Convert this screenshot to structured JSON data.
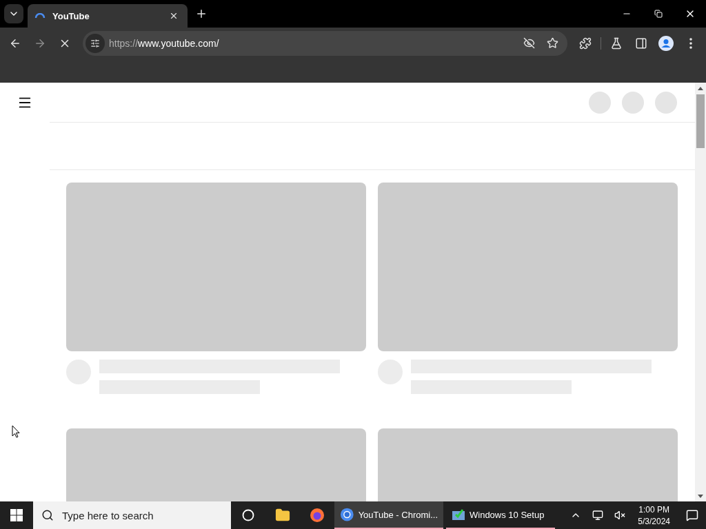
{
  "browser": {
    "tabs": [
      {
        "title": "YouTube",
        "selected": true,
        "loading": true
      }
    ],
    "address": {
      "scheme": "https://",
      "host": "www.youtube.com/"
    },
    "loading": true
  },
  "page": {
    "header_buttons": [
      {
        "kind": "placeholder"
      },
      {
        "kind": "placeholder"
      },
      {
        "kind": "placeholder"
      }
    ],
    "videos": [
      {
        "kind": "skeleton"
      },
      {
        "kind": "skeleton"
      },
      {
        "kind": "thumbnail-only"
      },
      {
        "kind": "thumbnail-only"
      }
    ]
  },
  "taskbar": {
    "search": {
      "placeholder": "Type here to search"
    },
    "pinned": [
      {
        "kind": "task-view"
      },
      {
        "kind": "folder"
      },
      {
        "kind": "firefox"
      }
    ],
    "windows": [
      {
        "label": "YouTube - Chromi...",
        "kind": "chromium",
        "selected": true
      },
      {
        "label": "Windows 10 Setup",
        "kind": "setup",
        "selected": false
      }
    ],
    "time": "1:00 PM",
    "date": "5/3/2024"
  }
}
